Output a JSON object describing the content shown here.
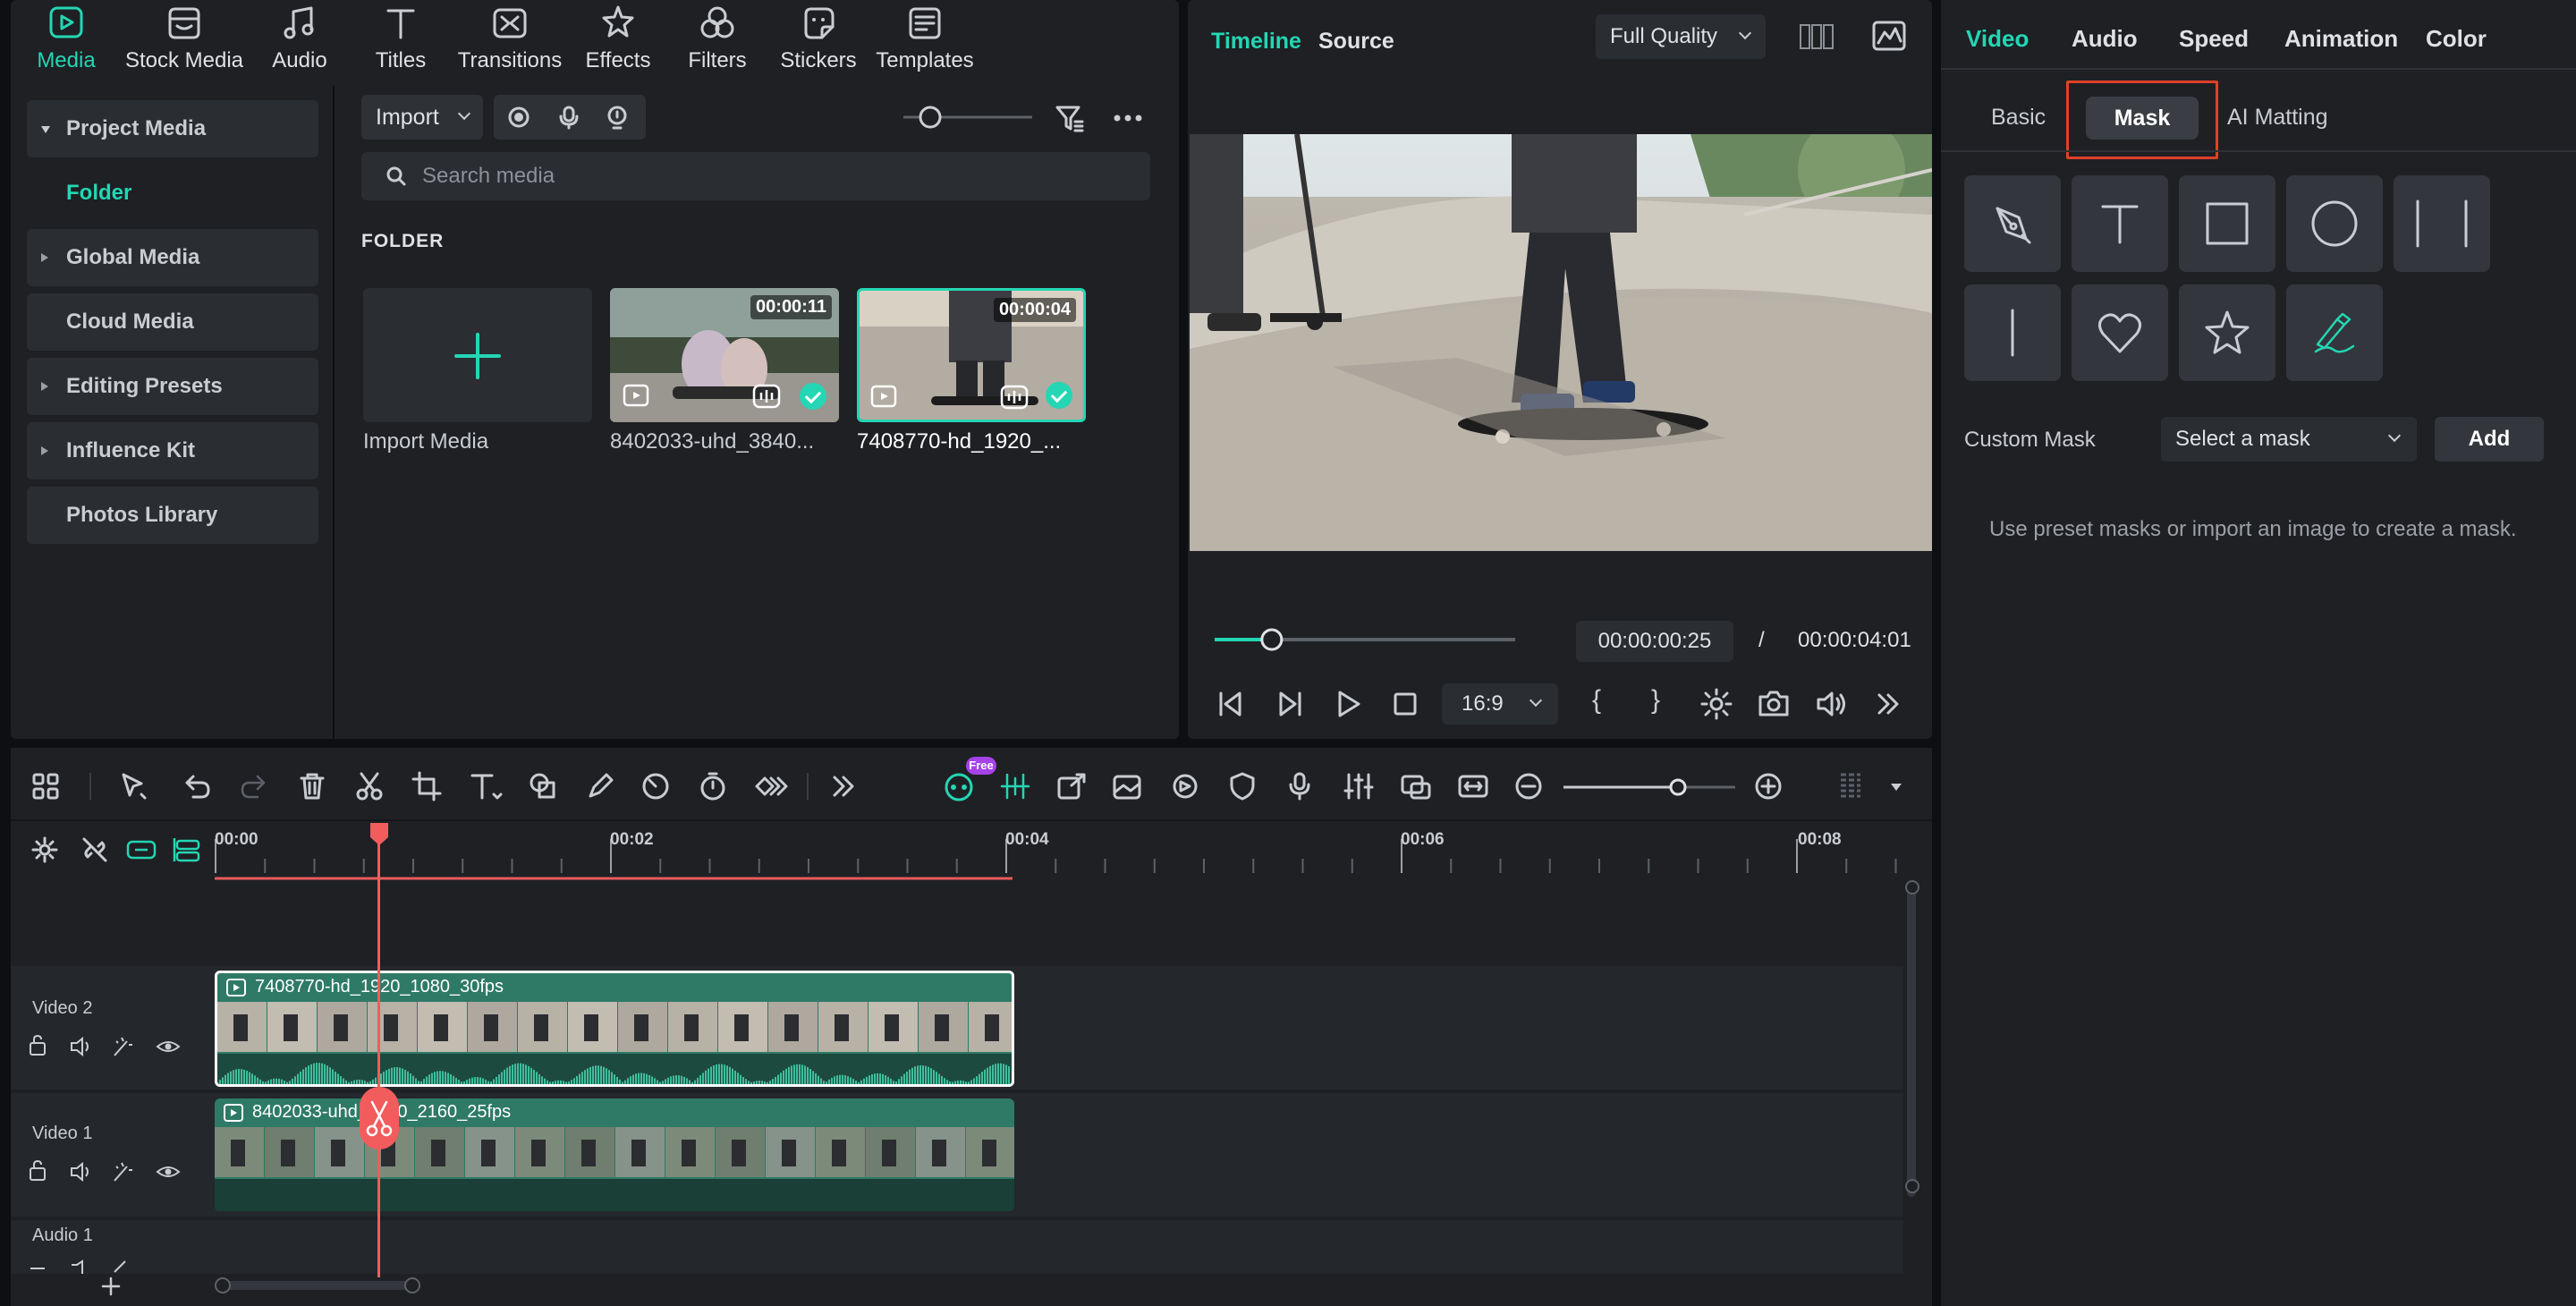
{
  "top_tabs": [
    {
      "label": "Media",
      "icon": "media-icon"
    },
    {
      "label": "Stock Media",
      "icon": "stock-media-icon"
    },
    {
      "label": "Audio",
      "icon": "audio-note-icon"
    },
    {
      "label": "Titles",
      "icon": "titles-icon"
    },
    {
      "label": "Transitions",
      "icon": "transitions-icon"
    },
    {
      "label": "Effects",
      "icon": "effects-icon"
    },
    {
      "label": "Filters",
      "icon": "filters-icon"
    },
    {
      "label": "Stickers",
      "icon": "stickers-icon"
    },
    {
      "label": "Templates",
      "icon": "templates-icon"
    }
  ],
  "media_tree": {
    "project_media": "Project Media",
    "folder": "Folder",
    "global_media": "Global Media",
    "cloud_media": "Cloud Media",
    "editing_presets": "Editing Presets",
    "influence_kit": "Influence Kit",
    "photos_library": "Photos Library"
  },
  "media_toolbar": {
    "import_label": "Import",
    "search_placeholder": "Search media",
    "folder_heading": "FOLDER"
  },
  "media_items": [
    {
      "name": "Import Media"
    },
    {
      "name": "8402033-uhd_3840...",
      "duration": "00:00:11"
    },
    {
      "name": "7408770-hd_1920_...",
      "duration": "00:00:04"
    }
  ],
  "preview": {
    "tab_timeline": "Timeline",
    "tab_source": "Source",
    "quality": "Full Quality",
    "current_time": "00:00:00:25",
    "separator": "/",
    "total_time": "00:00:04:01",
    "aspect": "16:9",
    "progress": 0.19,
    "brace_open": "{",
    "brace_close": "}"
  },
  "property_panel": {
    "tabs": [
      "Video",
      "Audio",
      "Speed",
      "Animation",
      "Color"
    ],
    "subtabs": [
      "Basic",
      "Mask",
      "AI Matting"
    ],
    "custom_mask_label": "Custom Mask",
    "select_placeholder": "Select a mask",
    "add_label": "Add",
    "hint": "Use preset masks or import an image to create a mask.",
    "mask_shapes": [
      "pen-mask-icon",
      "text-mask-icon",
      "rectangle-mask-icon",
      "circle-mask-icon",
      "double-line-mask-icon",
      "single-line-mask-icon",
      "heart-mask-icon",
      "star-mask-icon",
      "brush-mask-icon"
    ]
  },
  "timeline": {
    "free_badge": "Free",
    "ruler": [
      "00:00",
      "00:02",
      "00:04",
      "00:06",
      "00:08"
    ],
    "tracks": [
      {
        "name": "Video 2",
        "clip": "7408770-hd_1920_1080_30fps"
      },
      {
        "name": "Video 1",
        "clip": "8402033-uhd_3840_2160_25fps"
      },
      {
        "name": "Audio 1"
      }
    ]
  },
  "colors": {
    "accent": "#24d6b4",
    "playhead": "#f25c5c",
    "highlight_box": "#e0402a",
    "clip_green": "#2e7a66"
  }
}
